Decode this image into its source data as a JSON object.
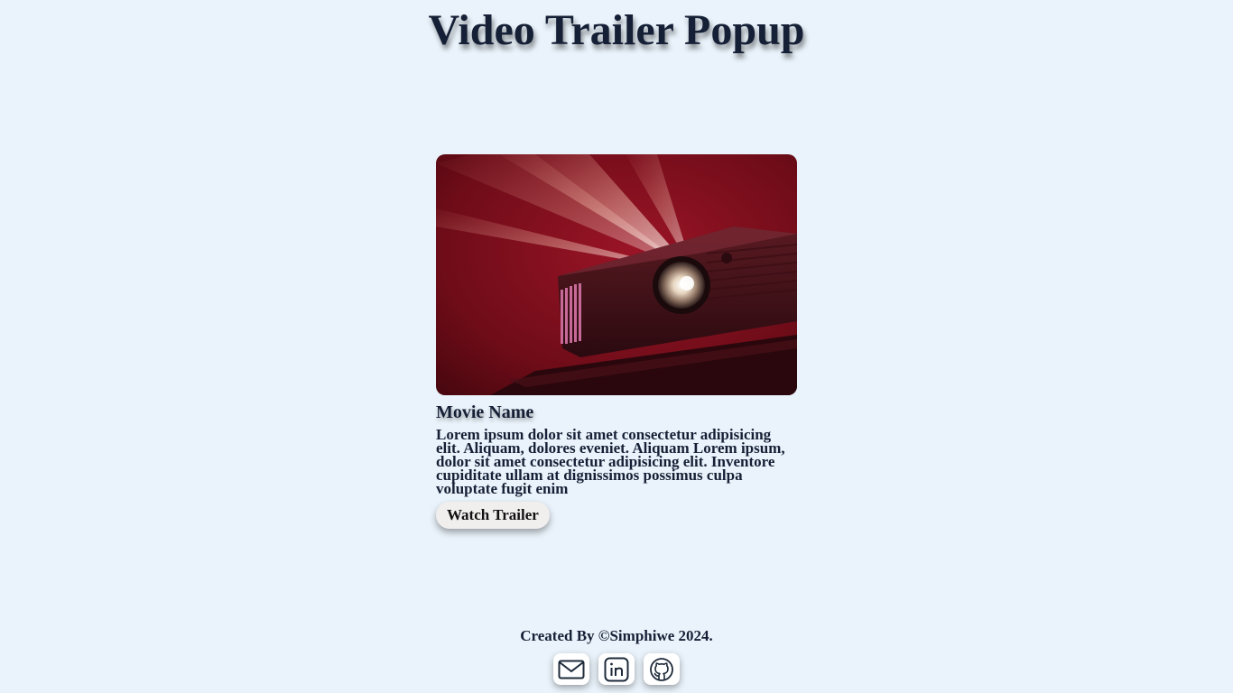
{
  "page": {
    "title": "Video Trailer Popup"
  },
  "card": {
    "movie_name": "Movie Name",
    "description": "Lorem ipsum dolor sit amet consectetur adipisicing elit. Aliquam, dolores eveniet. Aliquam Lorem ipsum, dolor sit amet consectetur adipisicing elit. Inventore cupiditate ullam at dignissimos possimus culpa voluptate fugit enim",
    "button_label": "Watch Trailer",
    "image_subject": "projector-beam-image"
  },
  "footer": {
    "credit": "Created By ©Simphiwe 2024.",
    "social_icons": [
      "mail-icon",
      "linkedin-icon",
      "github-icon"
    ]
  },
  "colors": {
    "background": "#eaf3fb",
    "text": "#152036",
    "button_bg": "#f1eeee",
    "poster_red": "#7a0d18"
  }
}
